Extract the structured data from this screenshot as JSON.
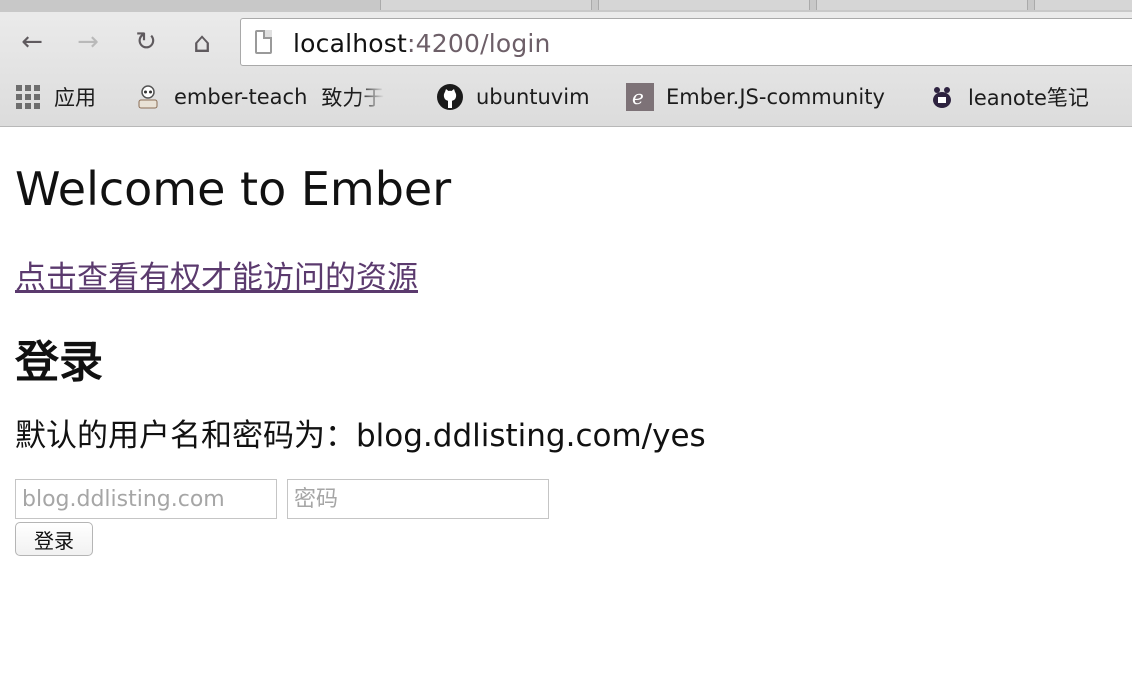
{
  "browser": {
    "nav": {
      "back_icon": "←",
      "forward_icon": "→",
      "reload_icon": "↻",
      "home_icon": "⌂"
    },
    "url": {
      "host": "localhost",
      "rest": ":4200/login"
    },
    "bookmarks": [
      {
        "label": "应用",
        "icon": "apps-grid-icon"
      },
      {
        "label": "ember-teach",
        "icon": "ember-teach-icon"
      },
      {
        "label": "致力于",
        "icon": ""
      },
      {
        "label": "ubuntuvim",
        "icon": "github-icon"
      },
      {
        "label": "Ember.JS-community",
        "icon": "ember-community-icon"
      },
      {
        "label": "leanote笔记",
        "icon": "leanote-icon"
      }
    ]
  },
  "page": {
    "title": "Welcome to Ember",
    "protected_link": "点击查看有权才能访问的资源",
    "login_heading": "登录",
    "hint": "默认的用户名和密码为：blog.ddlisting.com/yes",
    "username_placeholder": "blog.ddlisting.com",
    "password_placeholder": "密码",
    "login_button": "登录"
  }
}
